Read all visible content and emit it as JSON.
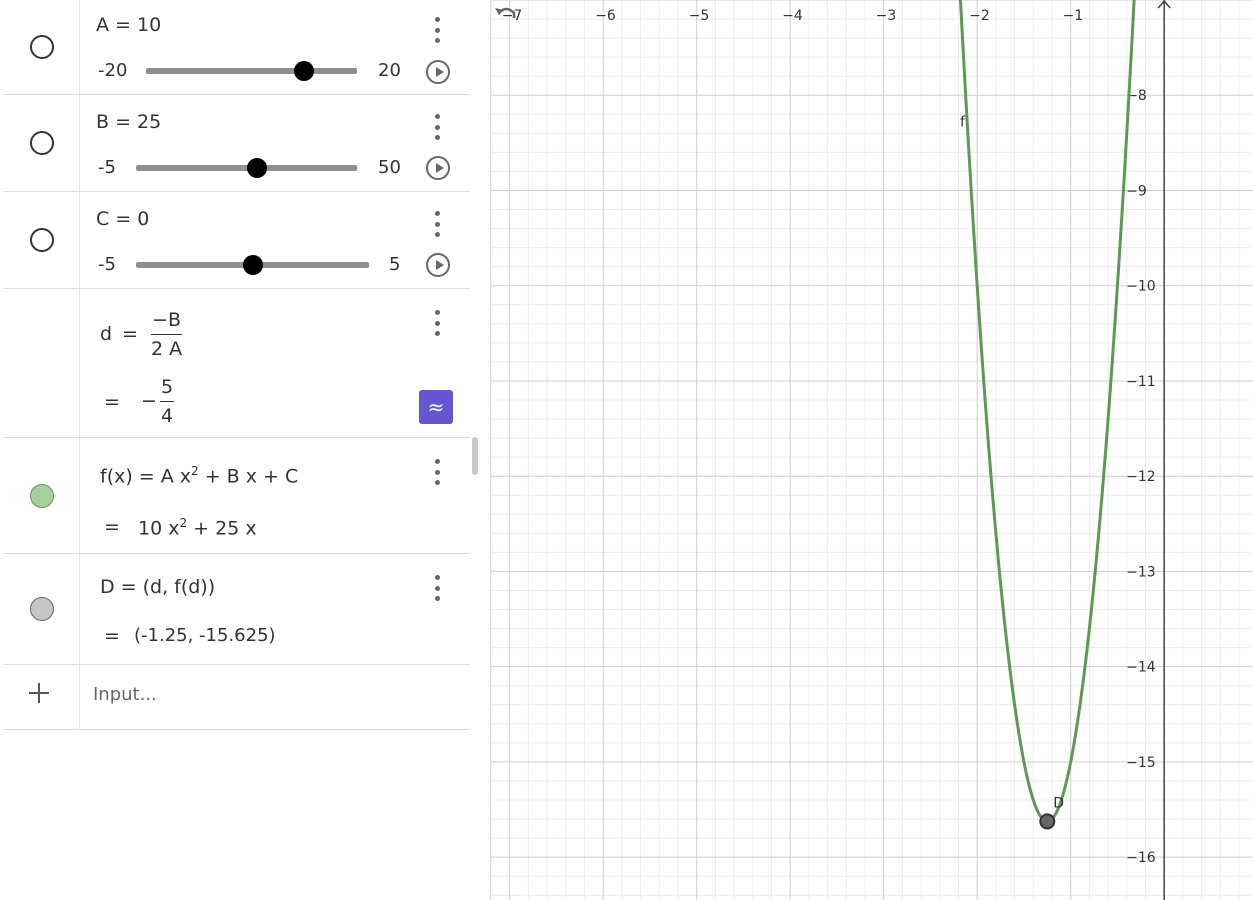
{
  "algebra": {
    "sliders": [
      {
        "label": "A = 10",
        "min": "-20",
        "max": "20",
        "value": 10,
        "range": [
          -20,
          20
        ]
      },
      {
        "label": "B = 25",
        "min": "-5",
        "max": "50",
        "value": 25,
        "range": [
          -5,
          50
        ]
      },
      {
        "label": "C = 0",
        "min": "-5",
        "max": "5",
        "value": 0,
        "range": [
          -5,
          5
        ]
      }
    ],
    "d": {
      "lhs": "d",
      "eq": "=",
      "numer": "−B",
      "denom": "2 A",
      "result_sign": "−",
      "result_numer": "5",
      "result_denom": "4",
      "approx_label": "≈"
    },
    "f": {
      "definition_start": "f(x)  =  A x",
      "definition_end": " + B x + C",
      "exp": "2",
      "result_start": "10 x",
      "result_end": " + 25 x",
      "eq": "="
    },
    "D": {
      "definition": "D  =  (d,  f(d))",
      "result": "(-1.25, -15.625)",
      "eq": "="
    },
    "input_placeholder": "Input..."
  },
  "graph": {
    "x_ticks": [
      "−7",
      "−6",
      "−5",
      "−4",
      "−3",
      "−2",
      "−1"
    ],
    "y_ticks": [
      "−8",
      "−9",
      "−10",
      "−11",
      "−12",
      "−13",
      "−14",
      "−15",
      "−16"
    ],
    "curve_label": "f",
    "point_label": "D",
    "curve_color": "#5c9a54",
    "point_color": "#666666"
  },
  "chart_data": {
    "type": "line",
    "function": "f(x) = 10x^2 + 25x",
    "xlim": [
      -7.2,
      0.95
    ],
    "ylim": [
      -16.45,
      -7.0
    ],
    "series": [
      {
        "name": "f",
        "a": 10,
        "b": 25,
        "c": 0
      }
    ],
    "points": [
      {
        "name": "D",
        "x": -1.25,
        "y": -15.625
      }
    ]
  }
}
